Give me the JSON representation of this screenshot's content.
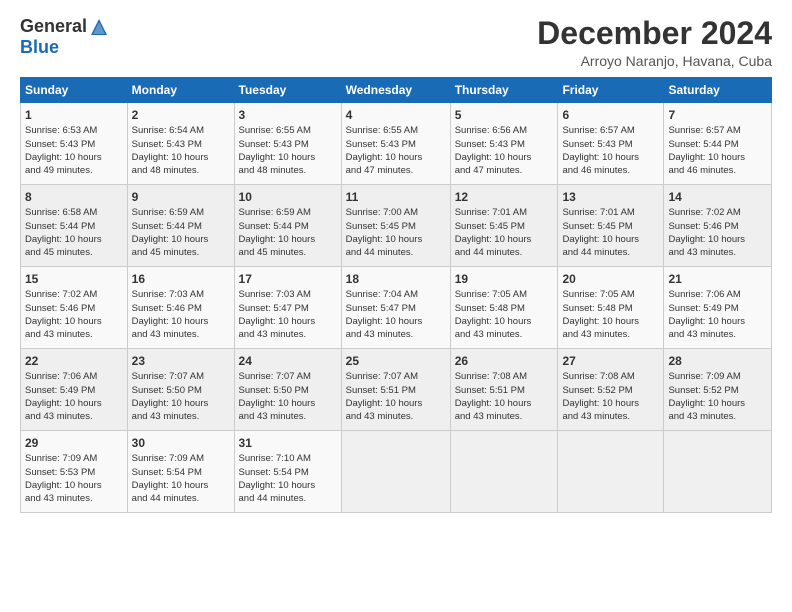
{
  "header": {
    "logo": {
      "general": "General",
      "blue": "Blue"
    },
    "title": "December 2024",
    "location": "Arroyo Naranjo, Havana, Cuba"
  },
  "weekdays": [
    "Sunday",
    "Monday",
    "Tuesday",
    "Wednesday",
    "Thursday",
    "Friday",
    "Saturday"
  ],
  "weeks": [
    [
      {
        "day": "1",
        "info": "Sunrise: 6:53 AM\nSunset: 5:43 PM\nDaylight: 10 hours\nand 49 minutes."
      },
      {
        "day": "2",
        "info": "Sunrise: 6:54 AM\nSunset: 5:43 PM\nDaylight: 10 hours\nand 48 minutes."
      },
      {
        "day": "3",
        "info": "Sunrise: 6:55 AM\nSunset: 5:43 PM\nDaylight: 10 hours\nand 48 minutes."
      },
      {
        "day": "4",
        "info": "Sunrise: 6:55 AM\nSunset: 5:43 PM\nDaylight: 10 hours\nand 47 minutes."
      },
      {
        "day": "5",
        "info": "Sunrise: 6:56 AM\nSunset: 5:43 PM\nDaylight: 10 hours\nand 47 minutes."
      },
      {
        "day": "6",
        "info": "Sunrise: 6:57 AM\nSunset: 5:43 PM\nDaylight: 10 hours\nand 46 minutes."
      },
      {
        "day": "7",
        "info": "Sunrise: 6:57 AM\nSunset: 5:44 PM\nDaylight: 10 hours\nand 46 minutes."
      }
    ],
    [
      {
        "day": "8",
        "info": "Sunrise: 6:58 AM\nSunset: 5:44 PM\nDaylight: 10 hours\nand 45 minutes."
      },
      {
        "day": "9",
        "info": "Sunrise: 6:59 AM\nSunset: 5:44 PM\nDaylight: 10 hours\nand 45 minutes."
      },
      {
        "day": "10",
        "info": "Sunrise: 6:59 AM\nSunset: 5:44 PM\nDaylight: 10 hours\nand 45 minutes."
      },
      {
        "day": "11",
        "info": "Sunrise: 7:00 AM\nSunset: 5:45 PM\nDaylight: 10 hours\nand 44 minutes."
      },
      {
        "day": "12",
        "info": "Sunrise: 7:01 AM\nSunset: 5:45 PM\nDaylight: 10 hours\nand 44 minutes."
      },
      {
        "day": "13",
        "info": "Sunrise: 7:01 AM\nSunset: 5:45 PM\nDaylight: 10 hours\nand 44 minutes."
      },
      {
        "day": "14",
        "info": "Sunrise: 7:02 AM\nSunset: 5:46 PM\nDaylight: 10 hours\nand 43 minutes."
      }
    ],
    [
      {
        "day": "15",
        "info": "Sunrise: 7:02 AM\nSunset: 5:46 PM\nDaylight: 10 hours\nand 43 minutes."
      },
      {
        "day": "16",
        "info": "Sunrise: 7:03 AM\nSunset: 5:46 PM\nDaylight: 10 hours\nand 43 minutes."
      },
      {
        "day": "17",
        "info": "Sunrise: 7:03 AM\nSunset: 5:47 PM\nDaylight: 10 hours\nand 43 minutes."
      },
      {
        "day": "18",
        "info": "Sunrise: 7:04 AM\nSunset: 5:47 PM\nDaylight: 10 hours\nand 43 minutes."
      },
      {
        "day": "19",
        "info": "Sunrise: 7:05 AM\nSunset: 5:48 PM\nDaylight: 10 hours\nand 43 minutes."
      },
      {
        "day": "20",
        "info": "Sunrise: 7:05 AM\nSunset: 5:48 PM\nDaylight: 10 hours\nand 43 minutes."
      },
      {
        "day": "21",
        "info": "Sunrise: 7:06 AM\nSunset: 5:49 PM\nDaylight: 10 hours\nand 43 minutes."
      }
    ],
    [
      {
        "day": "22",
        "info": "Sunrise: 7:06 AM\nSunset: 5:49 PM\nDaylight: 10 hours\nand 43 minutes."
      },
      {
        "day": "23",
        "info": "Sunrise: 7:07 AM\nSunset: 5:50 PM\nDaylight: 10 hours\nand 43 minutes."
      },
      {
        "day": "24",
        "info": "Sunrise: 7:07 AM\nSunset: 5:50 PM\nDaylight: 10 hours\nand 43 minutes."
      },
      {
        "day": "25",
        "info": "Sunrise: 7:07 AM\nSunset: 5:51 PM\nDaylight: 10 hours\nand 43 minutes."
      },
      {
        "day": "26",
        "info": "Sunrise: 7:08 AM\nSunset: 5:51 PM\nDaylight: 10 hours\nand 43 minutes."
      },
      {
        "day": "27",
        "info": "Sunrise: 7:08 AM\nSunset: 5:52 PM\nDaylight: 10 hours\nand 43 minutes."
      },
      {
        "day": "28",
        "info": "Sunrise: 7:09 AM\nSunset: 5:52 PM\nDaylight: 10 hours\nand 43 minutes."
      }
    ],
    [
      {
        "day": "29",
        "info": "Sunrise: 7:09 AM\nSunset: 5:53 PM\nDaylight: 10 hours\nand 43 minutes."
      },
      {
        "day": "30",
        "info": "Sunrise: 7:09 AM\nSunset: 5:54 PM\nDaylight: 10 hours\nand 44 minutes."
      },
      {
        "day": "31",
        "info": "Sunrise: 7:10 AM\nSunset: 5:54 PM\nDaylight: 10 hours\nand 44 minutes."
      },
      {
        "day": "",
        "info": ""
      },
      {
        "day": "",
        "info": ""
      },
      {
        "day": "",
        "info": ""
      },
      {
        "day": "",
        "info": ""
      }
    ]
  ]
}
